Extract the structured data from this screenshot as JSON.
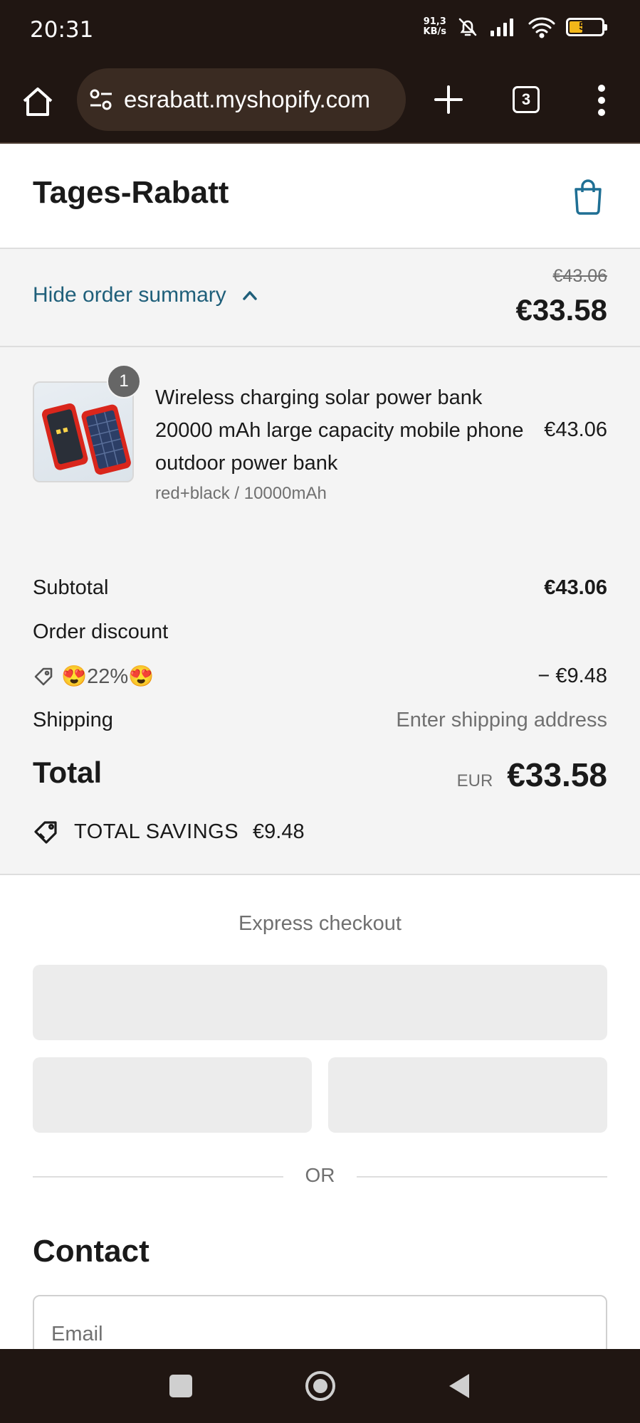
{
  "status_bar": {
    "time": "20:31",
    "net_speed_value": "91,3",
    "net_speed_unit": "KB/s",
    "battery": "52",
    "icons": [
      "mute-bell-icon",
      "signal-icon",
      "wifi-icon",
      "battery-icon"
    ]
  },
  "browser": {
    "url": "esrabatt.myshopify.com",
    "tab_count": "3",
    "icons": [
      "home-icon",
      "site-settings-icon",
      "plus-icon",
      "tabs-icon",
      "more-vert-icon"
    ]
  },
  "header": {
    "shop_name": "Tages-Rabatt",
    "cart_icon": "shopping-bag-icon"
  },
  "summary": {
    "toggle_label": "Hide order summary",
    "compare_at_total": "€43.06",
    "total": "€33.58",
    "product": {
      "quantity": "1",
      "title": "Wireless charging solar power bank 20000 mAh large capacity mobile phone outdoor power bank",
      "variant": "red+black / 10000mAh",
      "price": "€43.06"
    },
    "subtotal_label": "Subtotal",
    "subtotal_value": "€43.06",
    "discount_label": "Order discount",
    "discount_code": "😍22%😍",
    "discount_value": "− €9.48",
    "shipping_label": "Shipping",
    "shipping_value": "Enter shipping address",
    "total_label": "Total",
    "total_currency": "EUR",
    "total_value": "€33.58",
    "savings_label": "TOTAL SAVINGS",
    "savings_value": "€9.48"
  },
  "express": {
    "title": "Express checkout",
    "or_text": "OR"
  },
  "contact": {
    "title": "Contact",
    "email_placeholder": "Email"
  },
  "colors": {
    "accent_link": "#1f5f7a",
    "system_bar": "#201612",
    "summary_bg": "#f4f4f4"
  }
}
